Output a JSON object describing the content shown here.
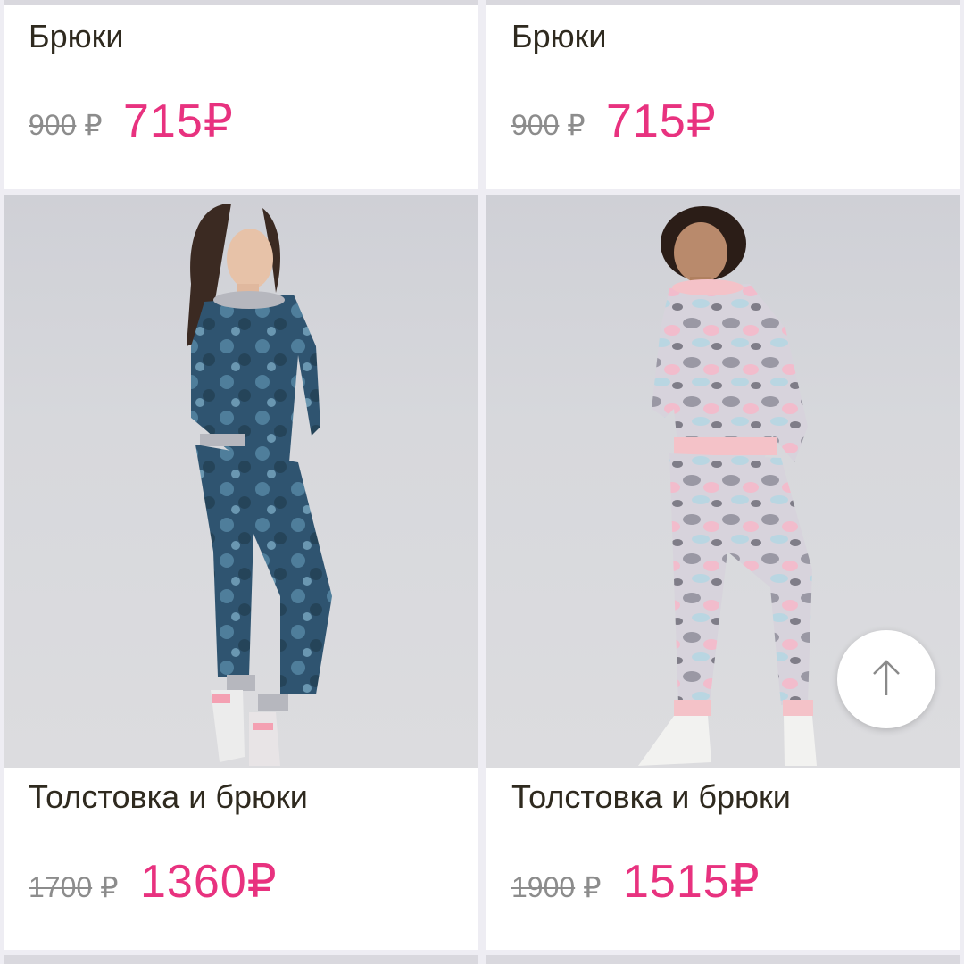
{
  "products": [
    {
      "title": "Брюки",
      "old_price": "900",
      "old_currency": "₽",
      "new_price": "715₽"
    },
    {
      "title": "Брюки",
      "old_price": "900",
      "old_currency": "₽",
      "new_price": "715₽"
    },
    {
      "title": "Толстовка и брюки",
      "old_price": "1700",
      "old_currency": "₽",
      "new_price": "1360₽",
      "image": "woman-in-blue-camo-tracksuit"
    },
    {
      "title": "Толстовка и брюки",
      "old_price": "1900",
      "old_currency": "₽",
      "new_price": "1515₽",
      "image": "girl-in-pink-camo-tracksuit"
    }
  ],
  "scroll_top": {
    "icon": "arrow-up-icon"
  },
  "colors": {
    "accent_price": "#e8327f",
    "old_price": "#8c8c8c",
    "title": "#2f2a1f",
    "page_bg": "#eeedf3"
  }
}
